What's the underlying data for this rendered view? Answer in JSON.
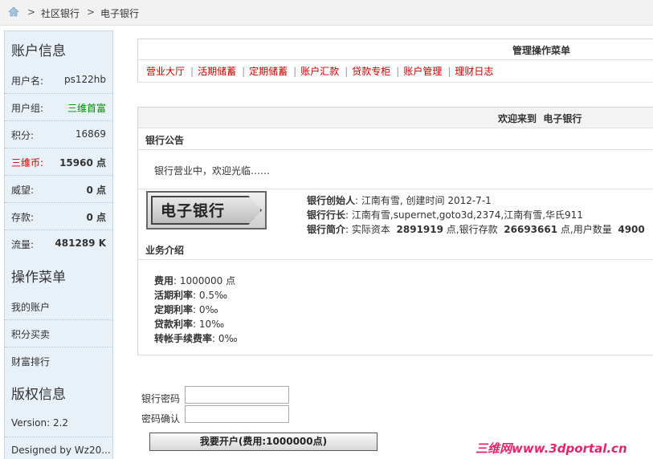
{
  "breadcrumb": {
    "sep": ">",
    "items": [
      "社区银行",
      "电子银行"
    ]
  },
  "sidebar": {
    "account_title": "账户信息",
    "account_rows": [
      {
        "label": "用户名:",
        "value": "ps122hb"
      },
      {
        "label": "用户组:",
        "value": "三维首富"
      },
      {
        "label": "积分:",
        "value": "16869"
      },
      {
        "label": "三维币:",
        "value": "15960 点"
      },
      {
        "label": "威望:",
        "value": "0 点"
      },
      {
        "label": "存款:",
        "value": "0 点"
      },
      {
        "label": "流量:",
        "value": "481289 K"
      }
    ],
    "menu_title": "操作菜单",
    "menu_items": [
      "我的账户",
      "积分买卖",
      "财富排行"
    ],
    "copyright_title": "版权信息",
    "copyright_rows": [
      "Version: 2.2",
      "Designed by Wz20..."
    ]
  },
  "menu_panel": {
    "title": "管理操作菜单",
    "items": [
      "营业大厅",
      "活期储蓄",
      "定期储蓄",
      "账户汇款",
      "贷款专柜",
      "账户管理",
      "理财日志"
    ]
  },
  "welcome_panel": {
    "title_prefix": "欢迎来到",
    "title_name": "电子银行",
    "notice_title": "银行公告",
    "notice_text": "银行营业中，欢迎光临……",
    "logo_text": "电子银行",
    "founder_label": "银行创始人",
    "founder_value": ": 江南有雪, 创建时间  2012-7-1",
    "president_label": "银行行长",
    "president_value": ": 江南有雪,supernet,goto3d,2374,江南有雪,华氏911",
    "intro_label": "银行简介",
    "intro_capital_prefix": ": 实际资本",
    "intro_capital": "2891919",
    "intro_deposit_prefix": "点,银行存款",
    "intro_deposit": "26693661",
    "intro_users_prefix": "点,用户数量",
    "intro_users": "4900",
    "biz_title": "业务介绍",
    "biz_rows": [
      {
        "label": "费用",
        "value": ": 1000000 点"
      },
      {
        "label": "活期利率",
        "value": ": 0.5‰"
      },
      {
        "label": "定期利率",
        "value": ": 0‰"
      },
      {
        "label": "贷款利率",
        "value": ": 10‰"
      },
      {
        "label": "转帐手续费率",
        "value": ": 0‰"
      }
    ]
  },
  "form": {
    "password_label": "银行密码",
    "confirm_label": "密码确认",
    "password_value": "",
    "confirm_value": "",
    "submit_label": "我要开户(费用:1000000点)"
  },
  "watermark": "三维网www.3dportal.cn",
  "colors": {
    "link_red": "#c00000",
    "sidebar_bg": "#e8f0f8",
    "group_green": "#008800"
  }
}
